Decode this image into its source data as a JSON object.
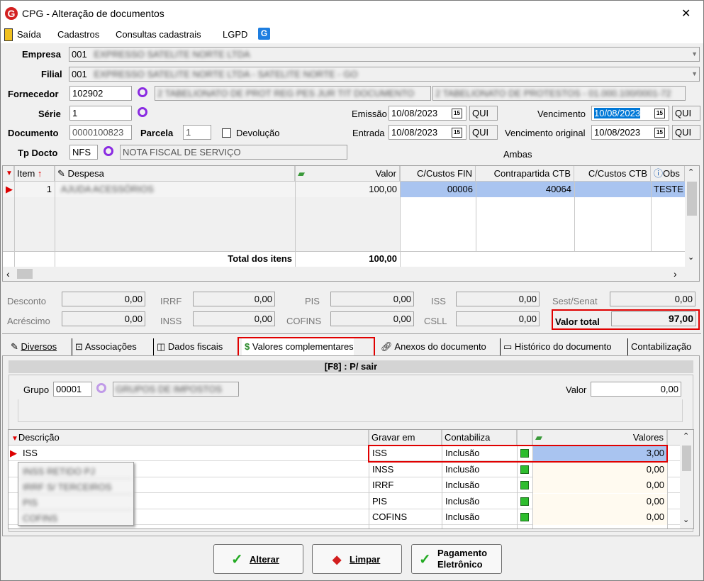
{
  "window": {
    "title": "CPG - Alteração de documentos",
    "close": "✕"
  },
  "menu": {
    "items": [
      "Saída",
      "Cadastros",
      "Consultas cadastrais",
      "LGPD"
    ]
  },
  "form": {
    "empresa_label": "Empresa",
    "empresa_code": "001",
    "empresa_name": "EXPRESSO SATELITE NORTE LTDA",
    "filial_label": "Filial",
    "filial_code": "001",
    "filial_name": "EXPRESSO SATELITE NORTE LTDA - SATELITE NORTE - GO",
    "fornecedor_label": "Fornecedor",
    "fornecedor_code": "102902",
    "fornecedor_name": "2 TABELIONATO DE PROT REG PES JUR TIT DOCUMENTO",
    "fornecedor_name2": "2 TABELIONATO DE PROTESTOS - 01.000.100/0001-72",
    "serie_label": "Série",
    "serie_value": "1",
    "documento_label": "Documento",
    "documento_value": "0000100823",
    "parcela_label": "Parcela",
    "parcela_value": "1",
    "devolucao_label": "Devolução",
    "tpdocto_label": "Tp Docto",
    "tpdocto_code": "NFS",
    "tpdocto_name": "NOTA FISCAL DE SERVIÇO",
    "emissao_label": "Emissão",
    "emissao_value": "10/08/2023",
    "emissao_day": "QUI",
    "entrada_label": "Entrada",
    "entrada_value": "10/08/2023",
    "entrada_day": "QUI",
    "vencimento_label": "Vencimento",
    "vencimento_value": "10/08/2023",
    "vencimento_day": "QUI",
    "vencorig_label": "Vencimento original",
    "vencorig_value": "10/08/2023",
    "vencorig_day": "QUI",
    "ambas": "Ambas",
    "cal_icon": "15"
  },
  "items_grid": {
    "headers": [
      "Item",
      "Despesa",
      "Valor",
      "C/Custos FIN",
      "Contrapartida CTB",
      "C/Custos CTB",
      "Obs"
    ],
    "row": {
      "item": "1",
      "despesa": "AJUDA ACESSÓRIOS",
      "valor": "100,00",
      "cc_fin": "00006",
      "contrapartida": "40064",
      "cc_ctb": "",
      "obs": "TESTE"
    },
    "total_label": "Total dos itens",
    "total_value": "100,00"
  },
  "totals": {
    "desconto_label": "Desconto",
    "desconto": "0,00",
    "irrf_label": "IRRF",
    "irrf": "0,00",
    "pis_label": "PIS",
    "pis": "0,00",
    "iss_label": "ISS",
    "iss": "0,00",
    "sest_label": "Sest/Senat",
    "sest": "0,00",
    "acrescimo_label": "Acréscimo",
    "acrescimo": "0,00",
    "inss_label": "INSS",
    "inss": "0,00",
    "cofins_label": "COFINS",
    "cofins": "0,00",
    "csll_label": "CSLL",
    "csll": "0,00",
    "valortotal_label": "Valor total",
    "valortotal": "97,00"
  },
  "tabs": [
    "Diversos",
    "Associações",
    "Dados fiscais",
    "Valores complementares",
    "Anexos do documento",
    "Histórico do documento",
    "Contabilização"
  ],
  "panel": {
    "header": "[F8] : P/ sair",
    "grupo_label": "Grupo",
    "grupo_code": "00001",
    "grupo_name": "GRUPOS DE IMPOSTOS",
    "valor_label": "Valor",
    "valor": "0,00"
  },
  "comp_grid": {
    "headers": [
      "Descrição",
      "Gravar em",
      "Contabiliza",
      "",
      "Valores"
    ],
    "rows": [
      {
        "descricao": "ISS",
        "gravar": "ISS",
        "contabiliza": "Inclusão",
        "valor": "3,00"
      },
      {
        "descricao": "",
        "gravar": "INSS",
        "contabiliza": "Inclusão",
        "valor": "0,00"
      },
      {
        "descricao": "",
        "gravar": "IRRF",
        "contabiliza": "Inclusão",
        "valor": "0,00"
      },
      {
        "descricao": "",
        "gravar": "PIS",
        "contabiliza": "Inclusão",
        "valor": "0,00"
      },
      {
        "descricao": "",
        "gravar": "COFINS",
        "contabiliza": "Inclusão",
        "valor": "0,00"
      }
    ],
    "dropdown": [
      "INSS RETIDO PJ",
      "IRRF S/ TERCEIROS",
      "PIS",
      "COFINS"
    ]
  },
  "buttons": {
    "alterar": "Alterar",
    "limpar": "Limpar",
    "pagamento1": "Pagamento",
    "pagamento2": "Eletrônico"
  },
  "colors": {
    "highlight_red": "#e00000",
    "selection_blue": "#0078d7",
    "row_blue": "#a9c4f0",
    "accent_green": "#2ebd2e"
  }
}
